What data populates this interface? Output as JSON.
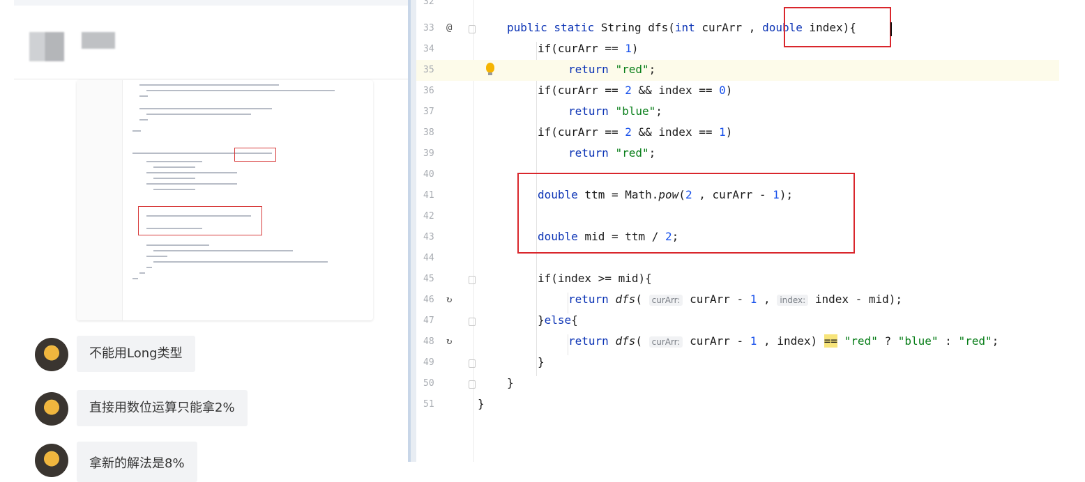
{
  "chat": {
    "messages": [
      {
        "text": "不能用Long类型"
      },
      {
        "text": "直接用数位运算只能拿2%"
      },
      {
        "text": "拿新的解法是8%"
      }
    ]
  },
  "editor": {
    "lines": [
      {
        "num": "32",
        "icon": ""
      },
      {
        "num": "33",
        "icon": "@"
      },
      {
        "num": "34",
        "icon": ""
      },
      {
        "num": "35",
        "icon": ""
      },
      {
        "num": "36",
        "icon": ""
      },
      {
        "num": "37",
        "icon": ""
      },
      {
        "num": "38",
        "icon": ""
      },
      {
        "num": "39",
        "icon": ""
      },
      {
        "num": "40",
        "icon": ""
      },
      {
        "num": "41",
        "icon": ""
      },
      {
        "num": "42",
        "icon": ""
      },
      {
        "num": "43",
        "icon": ""
      },
      {
        "num": "44",
        "icon": ""
      },
      {
        "num": "45",
        "icon": ""
      },
      {
        "num": "46",
        "icon": "recursion"
      },
      {
        "num": "47",
        "icon": ""
      },
      {
        "num": "48",
        "icon": "recursion"
      },
      {
        "num": "49",
        "icon": ""
      },
      {
        "num": "50",
        "icon": ""
      },
      {
        "num": "51",
        "icon": ""
      }
    ],
    "code": {
      "l33": {
        "t1": "public static",
        "t2": " String dfs(",
        "t3": "int",
        "t4": " curArr , ",
        "t5": "double",
        "t6": " index){"
      },
      "l34": {
        "t1": "if(curArr == ",
        "t2": "1",
        "t3": ")"
      },
      "l35": {
        "t1": "return",
        "t2": " ",
        "t3": "\"red\"",
        "t4": ";"
      },
      "l36": {
        "t1": "if(curArr == ",
        "t2": "2",
        "t3": " && index == ",
        "t4": "0",
        "t5": ")"
      },
      "l37": {
        "t1": "return",
        "t2": " ",
        "t3": "\"blue\"",
        "t4": ";"
      },
      "l38": {
        "t1": "if(curArr == ",
        "t2": "2",
        "t3": " && index == ",
        "t4": "1",
        "t5": ")"
      },
      "l39": {
        "t1": "return",
        "t2": " ",
        "t3": "\"red\"",
        "t4": ";"
      },
      "l41": {
        "t1": "double",
        "t2": " ttm = Math.",
        "t3": "pow",
        "t4": "(",
        "t5": "2",
        "t6": " , curArr - ",
        "t7": "1",
        "t8": ");"
      },
      "l43": {
        "t1": "double",
        "t2": " mid = ttm / ",
        "t3": "2",
        "t4": ";"
      },
      "l45": {
        "t1": "if(index >= mid){"
      },
      "l46": {
        "t1": "return",
        "t2": " ",
        "t3": "dfs",
        "t4": "( ",
        "h1": "curArr:",
        "t5": " curArr - ",
        "t6": "1",
        "t7": " , ",
        "h2": "index:",
        "t8": " index - mid);"
      },
      "l47": {
        "t1": "}",
        "t2": "else",
        "t3": "{"
      },
      "l48": {
        "t1": "return",
        "t2": " ",
        "t3": "dfs",
        "t4": "( ",
        "h1": "curArr:",
        "t5": " curArr - ",
        "t6": "1",
        "t7": " , index) ",
        "t8": "==",
        "t9": " ",
        "t10": "\"red\"",
        "t11": " ? ",
        "t12": "\"blue\"",
        "t13": " : ",
        "t14": "\"red\"",
        "t15": ";"
      },
      "l49": {
        "t1": "}"
      },
      "l50": {
        "t1": "}"
      },
      "l51": {
        "t1": "}"
      }
    }
  },
  "colors": {
    "keyword": "#0b33b5",
    "string": "#067d17",
    "number": "#1750eb",
    "annotation_box": "#d9262c",
    "current_line": "#fdfbea"
  },
  "icons": [
    "at-annotation-icon",
    "recursion-icon",
    "lightbulb-icon",
    "fold-icon",
    "avatar-monkey-icon"
  ]
}
